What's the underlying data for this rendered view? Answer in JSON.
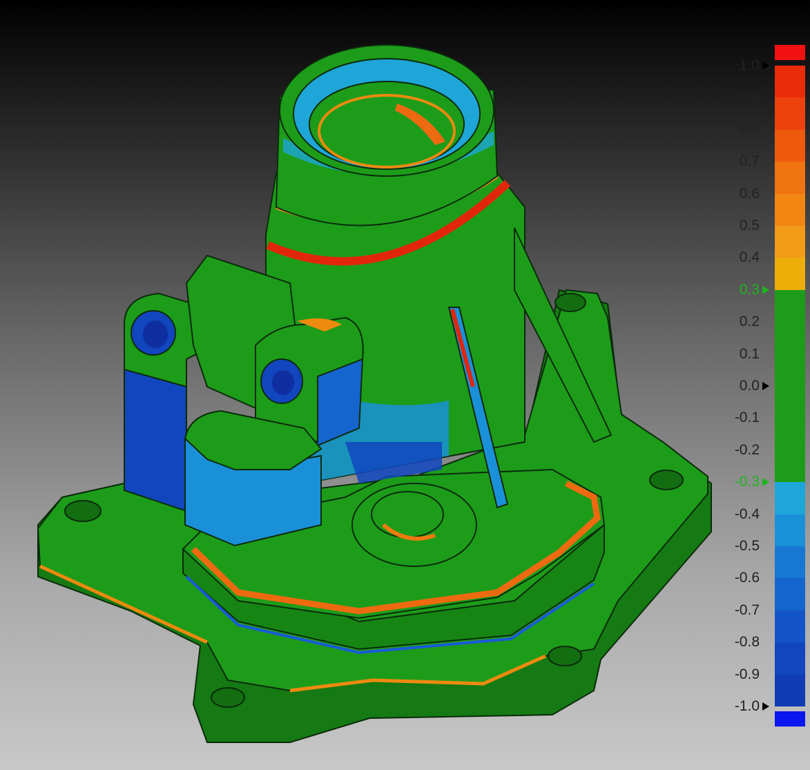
{
  "colormap": {
    "over_color": "#f21212",
    "under_color": "#0a17f0",
    "tolerance_color": "#1d9c1a",
    "bands": [
      {
        "from": 0.9,
        "to": 1.0,
        "color": "#ea2c0a"
      },
      {
        "from": 0.8,
        "to": 0.9,
        "color": "#ed420b"
      },
      {
        "from": 0.7,
        "to": 0.8,
        "color": "#ee5a0c"
      },
      {
        "from": 0.6,
        "to": 0.7,
        "color": "#f0740f"
      },
      {
        "from": 0.5,
        "to": 0.6,
        "color": "#f28613"
      },
      {
        "from": 0.4,
        "to": 0.5,
        "color": "#f39a18"
      },
      {
        "from": 0.3,
        "to": 0.4,
        "color": "#eeae0a"
      },
      {
        "from": -0.3,
        "to": 0.3,
        "color": "#1d9c1a"
      },
      {
        "from": -0.4,
        "to": -0.3,
        "color": "#1ea6d8"
      },
      {
        "from": -0.5,
        "to": -0.4,
        "color": "#1a90d8"
      },
      {
        "from": -0.6,
        "to": -0.5,
        "color": "#1778d4"
      },
      {
        "from": -0.7,
        "to": -0.6,
        "color": "#1565cf"
      },
      {
        "from": -0.8,
        "to": -0.7,
        "color": "#1355c8"
      },
      {
        "from": -0.9,
        "to": -0.8,
        "color": "#1146bf"
      },
      {
        "from": -1.0,
        "to": -0.9,
        "color": "#0f3cb5"
      }
    ],
    "labels": [
      {
        "text": "1.0",
        "value": 1.0,
        "arrow": true,
        "tol": false
      },
      {
        "text": "0.9",
        "value": 0.9,
        "arrow": false,
        "tol": false
      },
      {
        "text": "0.8",
        "value": 0.8,
        "arrow": false,
        "tol": false
      },
      {
        "text": "0.7",
        "value": 0.7,
        "arrow": false,
        "tol": false
      },
      {
        "text": "0.6",
        "value": 0.6,
        "arrow": false,
        "tol": false
      },
      {
        "text": "0.5",
        "value": 0.5,
        "arrow": false,
        "tol": false
      },
      {
        "text": "0.4",
        "value": 0.4,
        "arrow": false,
        "tol": false
      },
      {
        "text": "0.3",
        "value": 0.3,
        "arrow": true,
        "tol": true
      },
      {
        "text": "0.2",
        "value": 0.2,
        "arrow": false,
        "tol": false
      },
      {
        "text": "0.1",
        "value": 0.1,
        "arrow": false,
        "tol": false
      },
      {
        "text": "0.0",
        "value": 0.0,
        "arrow": true,
        "tol": false
      },
      {
        "text": "-0.1",
        "value": -0.1,
        "arrow": false,
        "tol": false
      },
      {
        "text": "-0.2",
        "value": -0.2,
        "arrow": false,
        "tol": false
      },
      {
        "text": "-0.3",
        "value": -0.3,
        "arrow": true,
        "tol": true
      },
      {
        "text": "-0.4",
        "value": -0.4,
        "arrow": false,
        "tol": false
      },
      {
        "text": "-0.5",
        "value": -0.5,
        "arrow": false,
        "tol": false
      },
      {
        "text": "-0.6",
        "value": -0.6,
        "arrow": false,
        "tol": false
      },
      {
        "text": "-0.7",
        "value": -0.7,
        "arrow": false,
        "tol": false
      },
      {
        "text": "-0.8",
        "value": -0.8,
        "arrow": false,
        "tol": false
      },
      {
        "text": "-0.9",
        "value": -0.9,
        "arrow": false,
        "tol": false
      },
      {
        "text": "-1.0",
        "value": -1.0,
        "arrow": true,
        "tol": false
      }
    ]
  },
  "model": {
    "base_color": "#1d9c1a",
    "edge_color": "#0b2a0b",
    "hot_color": "#ee5a0c",
    "cold_color": "#0f3cb5",
    "mid_cold_color": "#1a90d8"
  }
}
